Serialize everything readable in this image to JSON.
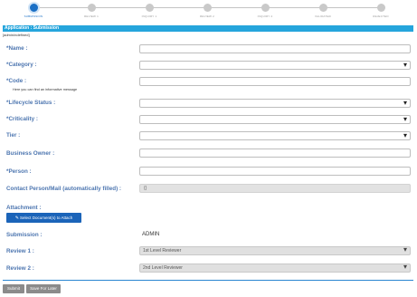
{
  "stepper": {
    "steps": [
      {
        "label": "SUBMISSION",
        "active": true
      },
      {
        "label": "REVIEW 1",
        "active": false
      },
      {
        "label": "INQUIRY 1",
        "active": false
      },
      {
        "label": "REVIEW 2",
        "active": false
      },
      {
        "label": "INQUIRY 2",
        "active": false
      },
      {
        "label": "VALIDATED",
        "active": false
      },
      {
        "label": "REJECTED",
        "active": false
      }
    ]
  },
  "header": {
    "title": "Application : Submission",
    "subpath": "[admin/ndefined]"
  },
  "form": {
    "name_label": "*Name :",
    "category_label": "*Category :",
    "code_label": "*Code :",
    "code_hint": "Here you can find an informative message",
    "lifecycle_label": "*Lifecycle Status :",
    "criticality_label": "*Criticality :",
    "tier_label": "Tier :",
    "business_owner_label": "Business Owner :",
    "person_label": "*Person :",
    "contact_label": "Contact Person/Mail (automatically filled) :",
    "contact_value": "{}",
    "attachment_label": "Attachment :",
    "attach_button": "Select Document(s) to Attach",
    "submission_label": "Submission :",
    "submission_value": "ADMIN",
    "review1_label": "Review 1 :",
    "review1_value": "1st Level Reviewer",
    "review2_label": "Review 2 :",
    "review2_value": "2nd Level Reviewer"
  },
  "footer": {
    "submit_label": "Submit",
    "save_later_label": "Save For Later"
  },
  "colors": {
    "accent": "#1a6fc5",
    "header_bar": "#25a5dc",
    "label": "#4d76b0"
  }
}
